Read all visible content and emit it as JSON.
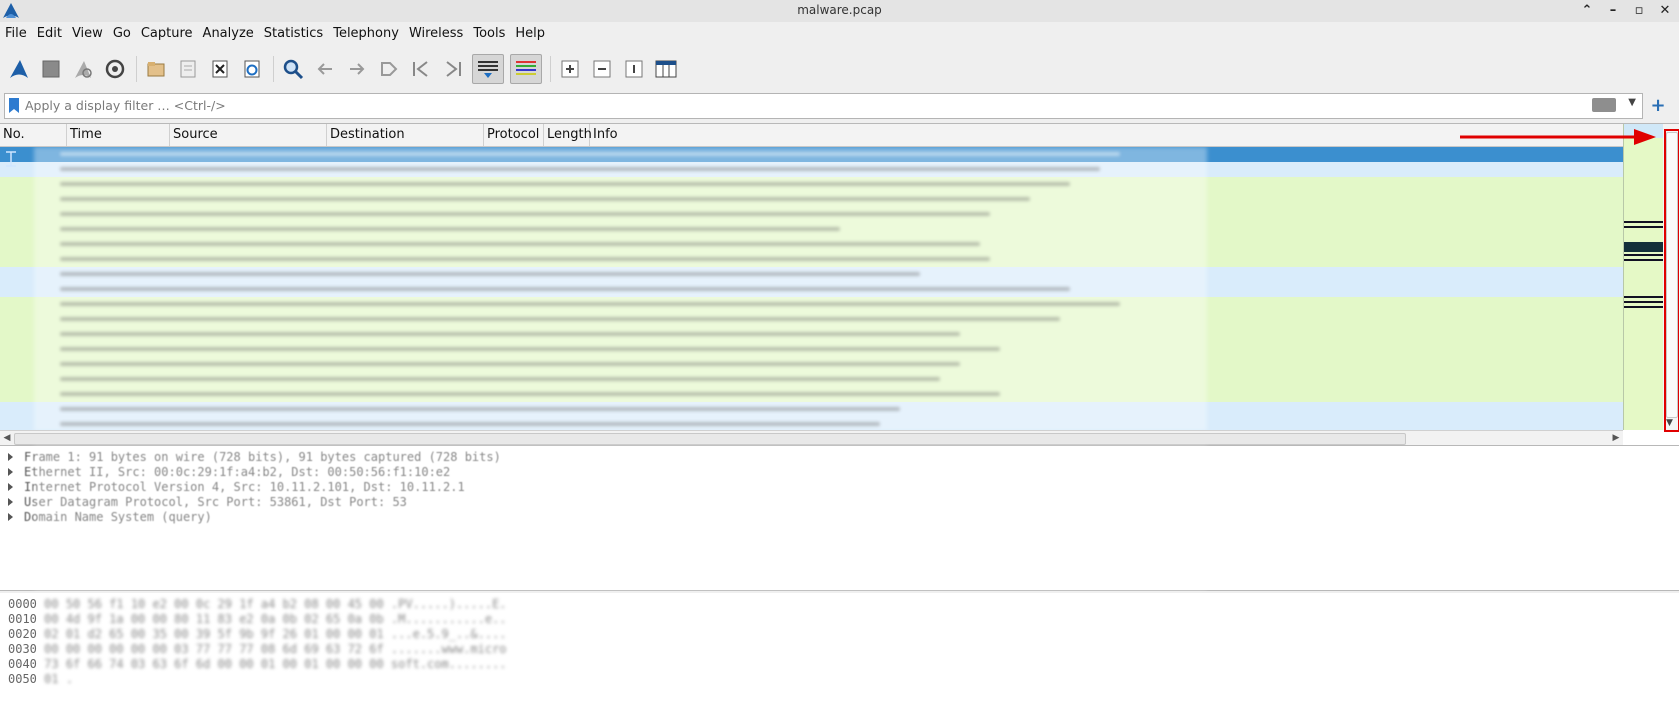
{
  "window": {
    "title": "malware.pcap"
  },
  "menu": [
    "File",
    "Edit",
    "View",
    "Go",
    "Capture",
    "Analyze",
    "Statistics",
    "Telephony",
    "Wireless",
    "Tools",
    "Help"
  ],
  "filter": {
    "placeholder": "Apply a display filter … <Ctrl-/>"
  },
  "columns": [
    "No.",
    "Time",
    "Source",
    "Destination",
    "Protocol",
    "Length",
    "Info"
  ],
  "details": {
    "rows": [
      "Frame 1: 91 bytes on wire (728 bits), 91 bytes captured (728 bits)",
      "Ethernet II, Src: 00:0c:29:1f:a4:b2, Dst: 00:50:56:f1:10:e2",
      "Internet Protocol Version 4, Src: 10.11.2.101, Dst: 10.11.2.1",
      "User Datagram Protocol, Src Port: 53861, Dst Port: 53",
      "Domain Name System (query)"
    ]
  },
  "bytes": {
    "offsets": [
      "0000",
      "0010",
      "0020",
      "0030",
      "0040",
      "0050"
    ],
    "lines": [
      "00 50 56 f1 10 e2 00 0c  29 1f a4 b2 08 00 45 00   .PV.....).....E.",
      "00 4d 9f 1a 00 00 80 11  83 e2 0a 0b 02 65 0a 0b   .M...........e..",
      "02 01 d2 65 00 35 00 39  5f 9b 9f 26 01 00 00 01   ...e.5.9_..&....",
      "00 00 00 00 00 00 03 77  77 77 08 6d 69 63 72 6f   .......www.micro",
      "73 6f 66 74 03 63 6f 6d  00 00 01 00 01 00 00 00   soft.com........",
      "01                                                 ."
    ]
  }
}
